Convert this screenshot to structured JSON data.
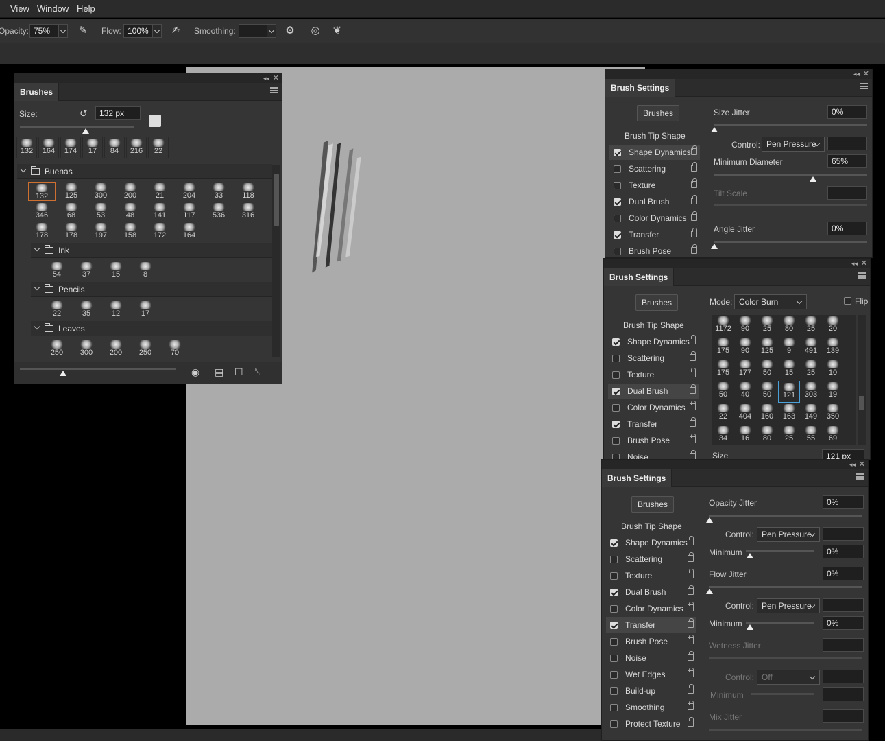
{
  "menu": {
    "items": [
      "View",
      "Window",
      "Help"
    ]
  },
  "options": {
    "opacity_label": "Opacity:",
    "opacity_value": "75%",
    "flow_label": "Flow:",
    "flow_value": "100%",
    "smoothing_label": "Smoothing:",
    "smoothing_value": "",
    "icons": [
      "airbrush-icon",
      "pressure-opacity-icon",
      "settings-gear-icon",
      "pressure-size-icon",
      "symmetry-icon"
    ]
  },
  "brushes_panel": {
    "tab": "Brushes",
    "size_label": "Size:",
    "size_value": "132 px",
    "recent": [
      "132",
      "164",
      "174",
      "17",
      "84",
      "216",
      "22"
    ],
    "groups": [
      {
        "name": "Buenas",
        "items": [
          "132",
          "125",
          "300",
          "200",
          "21",
          "204",
          "33",
          "118",
          "346",
          "68",
          "53",
          "48",
          "141",
          "117",
          "536",
          "316",
          "178",
          "178",
          "197",
          "158",
          "172",
          "164"
        ]
      },
      {
        "name": "Ink",
        "items": [
          "54",
          "37",
          "15",
          "8"
        ]
      },
      {
        "name": "Pencils",
        "items": [
          "22",
          "35",
          "12",
          "17"
        ]
      },
      {
        "name": "Leaves",
        "items": [
          "250",
          "300",
          "200",
          "250",
          "70"
        ]
      }
    ]
  },
  "bs1": {
    "tab": "Brush Settings",
    "brushes_btn": "Brushes",
    "list": [
      {
        "label": "Brush Tip Shape",
        "check": null
      },
      {
        "label": "Shape Dynamics",
        "check": true
      },
      {
        "label": "Scattering",
        "check": false
      },
      {
        "label": "Texture",
        "check": false
      },
      {
        "label": "Dual Brush",
        "check": true
      },
      {
        "label": "Color Dynamics",
        "check": false
      },
      {
        "label": "Transfer",
        "check": true
      },
      {
        "label": "Brush Pose",
        "check": false
      }
    ],
    "size_jitter_label": "Size Jitter",
    "size_jitter": "0%",
    "control_label": "Control:",
    "control_value": "Pen Pressure",
    "min_diam_label": "Minimum Diameter",
    "min_diam": "65%",
    "tilt_label": "Tilt Scale",
    "angle_label": "Angle Jitter",
    "angle_value": "0%",
    "min_diam_level": 0.65
  },
  "bs2": {
    "tab": "Brush Settings",
    "brushes_btn": "Brushes",
    "mode_label": "Mode:",
    "mode_value": "Color Burn",
    "flip_label": "Flip",
    "list": [
      {
        "label": "Brush Tip Shape",
        "check": null
      },
      {
        "label": "Shape Dynamics",
        "check": true
      },
      {
        "label": "Scattering",
        "check": false
      },
      {
        "label": "Texture",
        "check": false
      },
      {
        "label": "Dual Brush",
        "check": true
      },
      {
        "label": "Color Dynamics",
        "check": false
      },
      {
        "label": "Transfer",
        "check": true
      },
      {
        "label": "Brush Pose",
        "check": false
      },
      {
        "label": "Noise",
        "check": false
      }
    ],
    "grid": [
      "1172",
      "90",
      "25",
      "80",
      "25",
      "20",
      "175",
      "90",
      "125",
      "9",
      "491",
      "139",
      "175",
      "177",
      "50",
      "15",
      "25",
      "10",
      "50",
      "40",
      "50",
      "121",
      "303",
      "19",
      "22",
      "404",
      "160",
      "163",
      "149",
      "350",
      "34",
      "16",
      "80",
      "25",
      "55",
      "69"
    ],
    "size_label": "Size",
    "size_value": "121 px"
  },
  "bs3": {
    "tab": "Brush Settings",
    "brushes_btn": "Brushes",
    "list": [
      {
        "label": "Brush Tip Shape",
        "check": null
      },
      {
        "label": "Shape Dynamics",
        "check": true
      },
      {
        "label": "Scattering",
        "check": false
      },
      {
        "label": "Texture",
        "check": false
      },
      {
        "label": "Dual Brush",
        "check": true
      },
      {
        "label": "Color Dynamics",
        "check": false
      },
      {
        "label": "Transfer",
        "check": true
      },
      {
        "label": "Brush Pose",
        "check": false
      },
      {
        "label": "Noise",
        "check": false
      },
      {
        "label": "Wet Edges",
        "check": false
      },
      {
        "label": "Build-up",
        "check": false
      },
      {
        "label": "Smoothing",
        "check": false
      },
      {
        "label": "Protect Texture",
        "check": false
      }
    ],
    "opacity_jitter_label": "Opacity Jitter",
    "opacity_jitter": "0%",
    "control_label": "Control:",
    "control_value": "Pen Pressure",
    "minimum_label": "Minimum",
    "minimum_value": "0%",
    "flow_jitter_label": "Flow Jitter",
    "flow_jitter": "0%",
    "control2_value": "Pen Pressure",
    "minimum2_value": "0%",
    "wetness_label": "Wetness Jitter",
    "control3_value": "Off",
    "minimum3_label": "Minimum",
    "mix_label": "Mix Jitter"
  }
}
